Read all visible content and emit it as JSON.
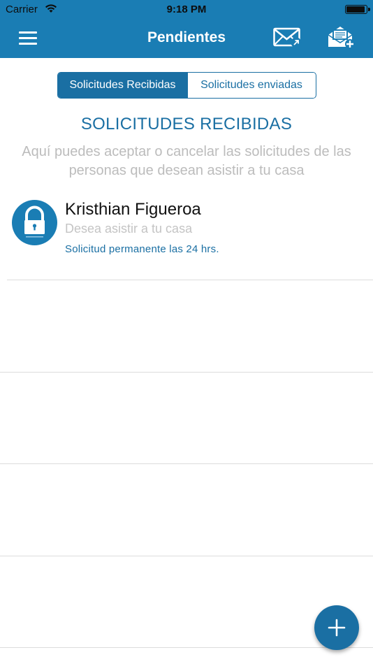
{
  "status_bar": {
    "carrier": "Carrier",
    "time": "9:18 PM",
    "wifi_icon": "wifi-icon",
    "battery_icon": "battery-icon",
    "battery_level": 0.95
  },
  "nav": {
    "title": "Pendientes",
    "menu_icon": "hamburger-menu-icon",
    "sent_icon": "mail-sent-icon",
    "new_request_icon": "mail-add-icon"
  },
  "tabs": [
    {
      "label": "Solicitudes Recibidas",
      "selected": true
    },
    {
      "label": "Solicitudes enviadas",
      "selected": false
    }
  ],
  "section": {
    "title": "SOLICITUDES RECIBIDAS",
    "description": "Aquí puedes aceptar o cancelar las solicitudes de las personas que desean asistir a tu casa"
  },
  "requests": [
    {
      "name": "Kristhian Figueroa",
      "subtitle": "Desea asistir a tu casa",
      "detail": "Solicitud permanente las 24 hrs.",
      "avatar_icon": "lock-logo-icon"
    }
  ],
  "fab": {
    "icon": "plus-icon"
  },
  "colors": {
    "primary": "#1a7db4",
    "accent": "#1a6fa3",
    "muted_text": "#bcbcbc",
    "separator": "#dcdcdc"
  }
}
